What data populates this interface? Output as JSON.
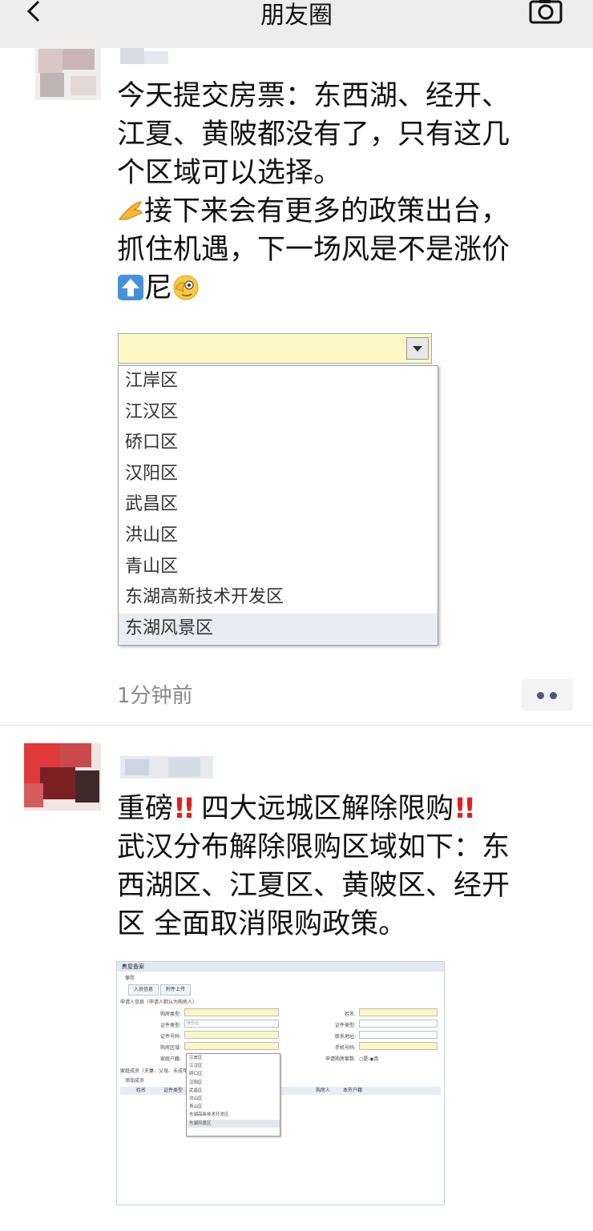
{
  "header": {
    "title": "朋友圈",
    "back_icon": "chevron-left-icon",
    "camera_icon": "camera-icon"
  },
  "post1": {
    "lines": [
      "今天提交房票：东西湖、经开、",
      "江夏、黄陂都没有了，只有这几",
      "个区域可以选择。",
      "接下来会有更多的政策出台，",
      "抓住机遇，下一场风是不是涨价",
      "尼"
    ],
    "dropdown": {
      "options": [
        "江岸区",
        "江汉区",
        "硚口区",
        "汉阳区",
        "武昌区",
        "洪山区",
        "青山区",
        "东湖高新技术开发区",
        "东湖风景区"
      ],
      "highlighted": "东湖风景区"
    },
    "time": "1分钟前"
  },
  "post2": {
    "lines": [
      "重磅",
      "四大远城区解除限购",
      "武汉分布解除限购区域如下：东",
      "西湖区、江夏区、黄陂区、经开",
      "区 全面取消限购政策。"
    ],
    "screenshot": {
      "title": "房屋备案",
      "close": "✕",
      "save": "保存",
      "tabs": [
        "人员信息",
        "附件上传"
      ],
      "section1": "申请人信息（申请人默认为购房人）",
      "labels_left": [
        "购房类型:",
        "证件类型:",
        "证件号码:",
        "购房区域:",
        "家庭户籍:"
      ],
      "labels_right": [
        "姓名:",
        "证件类型:",
        "联系地址:",
        "手机号码:",
        "申请购房套数:"
      ],
      "placeholder1": "身份证",
      "radio": "○是  ◉否",
      "section2": "家庭成员（夫妻、父母、未成年子女）",
      "grid_toolbar": "添加成员",
      "grid_cols": [
        "姓名",
        "证件类型",
        "购房人",
        "本市户籍"
      ],
      "dropdown": [
        "江岸区",
        "江汉区",
        "硚口区",
        "汉阳区",
        "武昌区",
        "洪山区",
        "青山区",
        "东湖高新技术开发区",
        "东湖风景区"
      ]
    }
  }
}
